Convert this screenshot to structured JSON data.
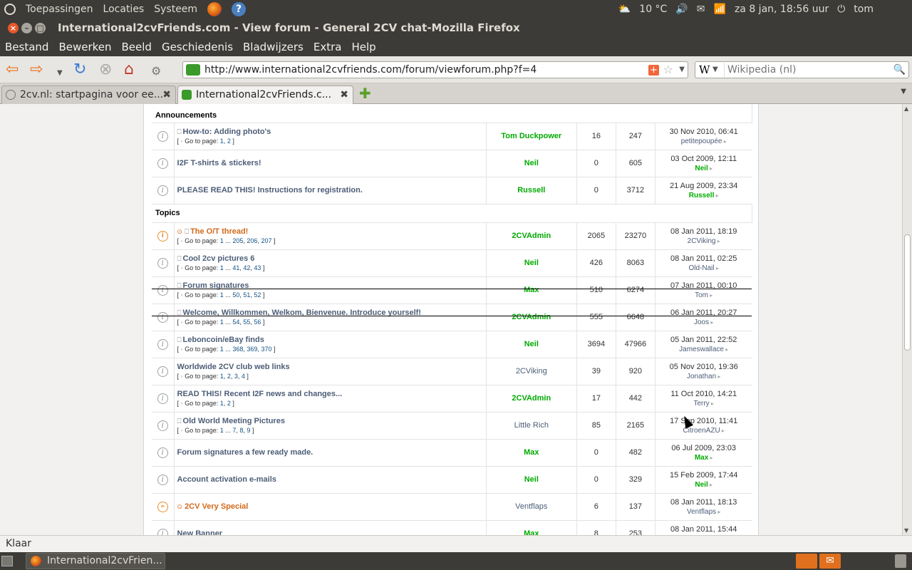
{
  "top_panel": {
    "menus": [
      "Toepassingen",
      "Locaties",
      "Systeem"
    ],
    "temperature": "10 °C",
    "clock": "za  8 jan, 18:56 uur",
    "user": "tom"
  },
  "window": {
    "title": "International2cvFriends.com - View forum - General 2CV chat-Mozilla Firefox"
  },
  "menubar": [
    "Bestand",
    "Bewerken",
    "Beeld",
    "Geschiedenis",
    "Bladwijzers",
    "Extra",
    "Help"
  ],
  "navbar": {
    "url": "http://www.international2cvfriends.com/forum/viewforum.php?f=4",
    "search_engine_glyph": "W",
    "search_placeholder": "Wikipedia (nl)"
  },
  "tabs": [
    {
      "label": "2cv.nl: startpagina voor ee...",
      "active": false
    },
    {
      "label": "International2cvFriends.c...",
      "active": true
    }
  ],
  "forum": {
    "announcements_label": "Announcements",
    "topics_label": "Topics",
    "announcements": [
      {
        "title": "How-to: Adding photo's",
        "pages": [
          "1",
          "2"
        ],
        "author": "Tom Duckpower",
        "author_type": "mod",
        "replies": "16",
        "views": "247",
        "last_date": "30 Nov 2010, 06:41",
        "last_by": "petitepoupée",
        "last_by_type": "reg",
        "attach": true,
        "hot": false
      },
      {
        "title": "I2F T-shirts & stickers!",
        "pages": [],
        "author": "Neil",
        "author_type": "mod",
        "replies": "0",
        "views": "605",
        "last_date": "03 Oct 2009, 12:11",
        "last_by": "Neil",
        "last_by_type": "mod",
        "attach": false,
        "hot": false
      },
      {
        "title": "PLEASE READ THIS! Instructions for registration.",
        "pages": [],
        "author": "Russell",
        "author_type": "mod",
        "replies": "0",
        "views": "3712",
        "last_date": "21 Aug 2009, 23:34",
        "last_by": "Russell",
        "last_by_type": "mod",
        "attach": false,
        "hot": false
      }
    ],
    "topics": [
      {
        "title": "The O/T thread!",
        "pages": [
          "1",
          "...",
          "205",
          "206",
          "207"
        ],
        "author": "2CVAdmin",
        "author_type": "mod",
        "replies": "2065",
        "views": "23270",
        "last_date": "08 Jan 2011, 18:19",
        "last_by": "2CViking",
        "last_by_type": "reg",
        "attach": true,
        "hot": true
      },
      {
        "title": "Cool 2cv pictures 6",
        "pages": [
          "1",
          "...",
          "41",
          "42",
          "43"
        ],
        "author": "Neil",
        "author_type": "mod",
        "replies": "426",
        "views": "8063",
        "last_date": "08 Jan 2011, 02:25",
        "last_by": "Old-Nail",
        "last_by_type": "reg",
        "attach": true,
        "hot": false
      },
      {
        "title": "Forum signatures",
        "pages": [
          "1",
          "...",
          "50",
          "51",
          "52"
        ],
        "author": "Max",
        "author_type": "mod",
        "replies": "510",
        "views": "6274",
        "last_date": "07 Jan 2011, 00:10",
        "last_by": "Tom",
        "last_by_type": "reg",
        "attach": true,
        "hot": false,
        "struck": true
      },
      {
        "title": "Welcome, Willkommen, Welkom, Bienvenue. Introduce yourself!",
        "pages": [
          "1",
          "...",
          "54",
          "55",
          "56"
        ],
        "author": "2CVAdmin",
        "author_type": "mod",
        "replies": "555",
        "views": "6648",
        "last_date": "06 Jan 2011, 20:27",
        "last_by": "Joos",
        "last_by_type": "reg",
        "attach": true,
        "hot": false,
        "struck": true
      },
      {
        "title": "Leboncoin/eBay finds",
        "pages": [
          "1",
          "...",
          "368",
          "369",
          "370"
        ],
        "author": "Neil",
        "author_type": "mod",
        "replies": "3694",
        "views": "47966",
        "last_date": "05 Jan 2011, 22:52",
        "last_by": "Jameswallace",
        "last_by_type": "reg",
        "attach": true,
        "hot": false
      },
      {
        "title": "Worldwide 2CV club web links",
        "pages": [
          "1",
          "2",
          "3",
          "4"
        ],
        "author": "2CViking",
        "author_type": "reg",
        "replies": "39",
        "views": "920",
        "last_date": "05 Nov 2010, 19:36",
        "last_by": "Jonathan",
        "last_by_type": "reg",
        "attach": false,
        "hot": false
      },
      {
        "title": "READ THIS! Recent I2F news and changes...",
        "pages": [
          "1",
          "2"
        ],
        "author": "2CVAdmin",
        "author_type": "mod",
        "replies": "17",
        "views": "442",
        "last_date": "11 Oct 2010, 14:21",
        "last_by": "Terry",
        "last_by_type": "reg",
        "attach": false,
        "hot": false
      },
      {
        "title": "Old World Meeting Pictures",
        "pages": [
          "1",
          "...",
          "7",
          "8",
          "9"
        ],
        "author": "Little Rich",
        "author_type": "reg",
        "replies": "85",
        "views": "2165",
        "last_date": "17 Sep 2010, 11:41",
        "last_by": "CitroenAZU",
        "last_by_type": "reg",
        "attach": true,
        "hot": false
      },
      {
        "title": "Forum signatures a few ready made.",
        "pages": [],
        "author": "Max",
        "author_type": "mod",
        "replies": "0",
        "views": "482",
        "last_date": "06 Jul 2009, 23:03",
        "last_by": "Max",
        "last_by_type": "mod",
        "attach": false,
        "hot": false
      },
      {
        "title": "Account activation e-mails",
        "pages": [],
        "author": "Neil",
        "author_type": "mod",
        "replies": "0",
        "views": "329",
        "last_date": "15 Feb 2009, 17:44",
        "last_by": "Neil",
        "last_by_type": "mod",
        "attach": false,
        "hot": false
      },
      {
        "title": "2CV Very Special",
        "pages": [],
        "author": "Ventflaps",
        "author_type": "reg",
        "replies": "6",
        "views": "137",
        "last_date": "08 Jan 2011, 18:13",
        "last_by": "Ventflaps",
        "last_by_type": "reg",
        "attach": false,
        "hot": true,
        "moved": true
      },
      {
        "title": "New Banner",
        "pages": [],
        "author": "Max",
        "author_type": "mod",
        "replies": "8",
        "views": "253",
        "last_date": "08 Jan 2011, 15:44",
        "last_by": "",
        "last_by_type": "reg",
        "attach": false,
        "hot": false
      }
    ]
  },
  "statusbar": {
    "text": "Klaar"
  },
  "taskbar": {
    "task_label": "International2cvFrien..."
  }
}
